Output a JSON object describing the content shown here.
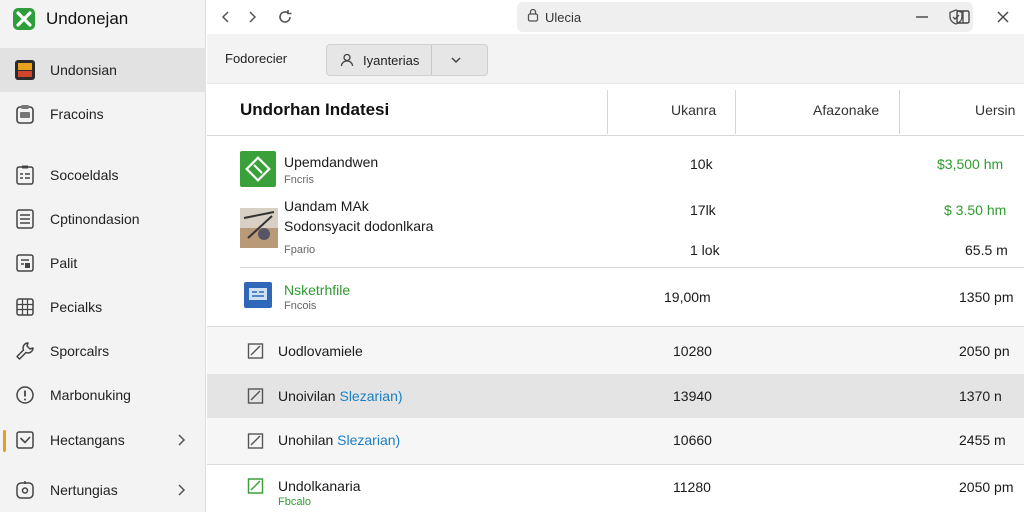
{
  "app": {
    "title": "Undonejan"
  },
  "sidebar": {
    "items": [
      {
        "label": "Undonsian",
        "icon": "app-tile-icon"
      },
      {
        "label": "Fracoins",
        "icon": "clipboard-icon"
      },
      {
        "label": "Socoeldals",
        "icon": "checklist-icon"
      },
      {
        "label": "Cptinondasion",
        "icon": "document-icon"
      },
      {
        "label": "Palit",
        "icon": "page-edit-icon"
      },
      {
        "label": "Pecialks",
        "icon": "grid-icon"
      },
      {
        "label": "Sporcalrs",
        "icon": "wrench-icon"
      },
      {
        "label": "Marbonuking",
        "icon": "info-circle-icon"
      },
      {
        "label": "Hectangans",
        "icon": "checkbox-icon"
      },
      {
        "label": "Nertungias",
        "icon": "settings-icon"
      }
    ]
  },
  "titlebar": {
    "address_text": "Ulecia"
  },
  "toolbar": {
    "label": "Fodorecier",
    "filter_text": "Iyanterias"
  },
  "table": {
    "columns": {
      "main": "Undorhan Indatesi",
      "c1": "Ukanra",
      "c2": "Afazonake",
      "c3": "Uersin"
    },
    "rows": [
      {
        "name": "Upemdandwen",
        "sub": "Fncris",
        "c1": "10k",
        "c3": "$3,500 hm"
      },
      {
        "name": "Uandam MAk",
        "name2": "Sodonsyacit dodonlkara",
        "sub": "Fpario",
        "c1": "17lk",
        "c3": "$ 3.50 hm",
        "c1b": "1 lok",
        "c3b": "65.5 m"
      },
      {
        "name": "Nsketrhfile",
        "sub": "Fncois",
        "c1": "19,00m",
        "c3": "1350 pm"
      },
      {
        "name": "Uodlovamiele",
        "c1": "10280",
        "c3": "2050 pn"
      },
      {
        "name": "Unoivilan",
        "name_accent": "Slezarian)",
        "c1": "13940",
        "c3": "1370 n"
      },
      {
        "name": "Unohilan",
        "name_accent": "Slezarian)",
        "c1": "10660",
        "c3": "2455 m"
      },
      {
        "name": "Undolkanaria",
        "sub": "Fbcalo",
        "c1": "11280",
        "c3": "2050 pm"
      }
    ]
  },
  "colors": {
    "accent_green": "#2f9a2f",
    "accent_blue": "#1a7fc4",
    "indicator": "#e0a020"
  }
}
